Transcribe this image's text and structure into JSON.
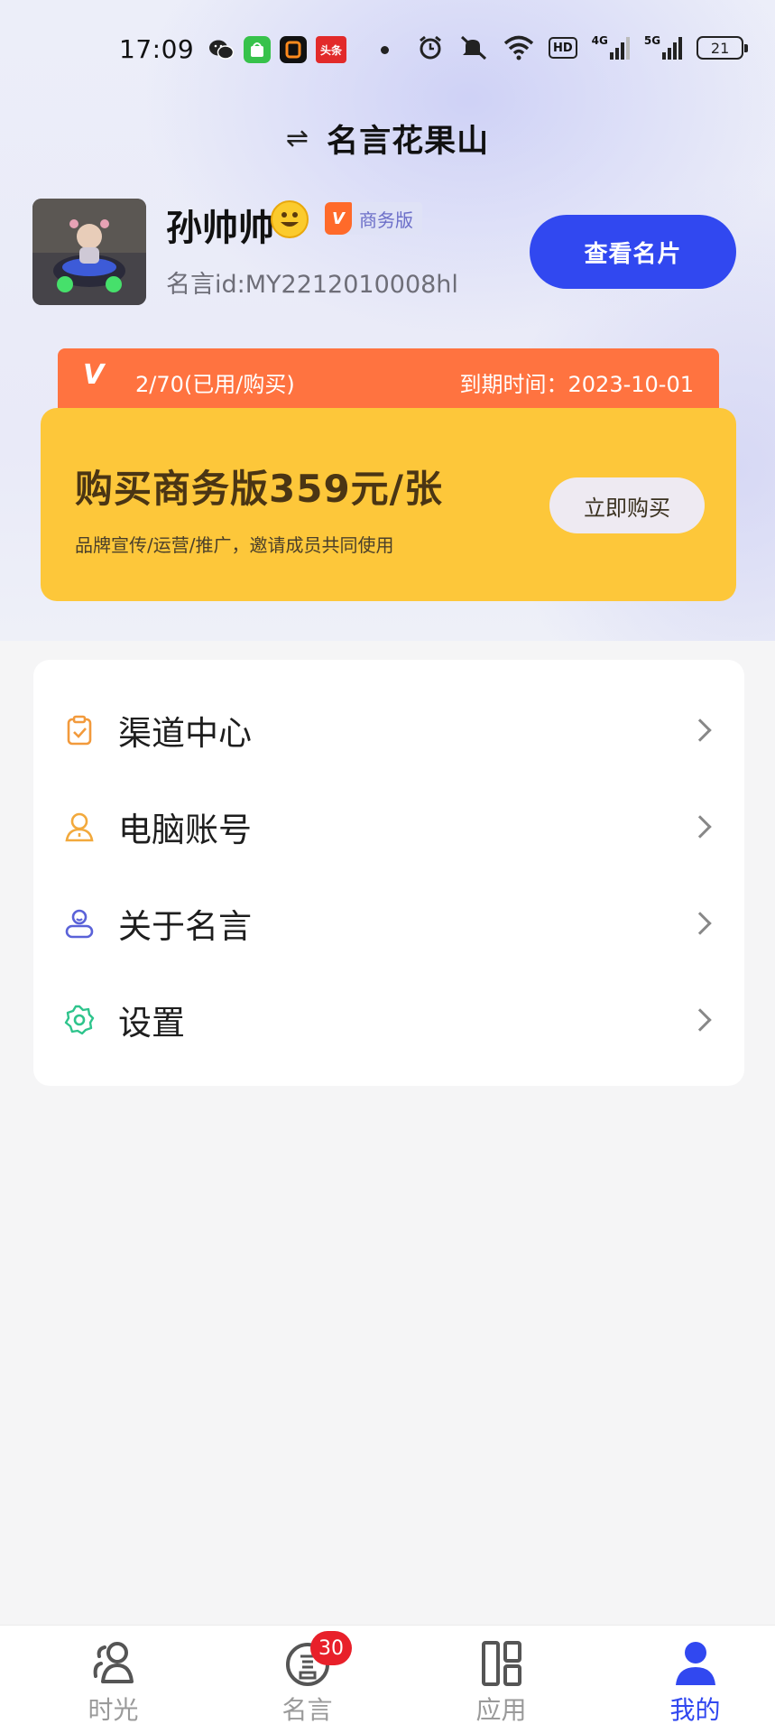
{
  "status_bar": {
    "time": "17:09",
    "notification_icons": [
      "wechat-icon",
      "android-market-icon",
      "bracket-app-icon",
      "toutiao-icon"
    ],
    "toutiao_label": "头条",
    "network_hd": "HD",
    "network_4g": "4G",
    "network_5g": "5G",
    "battery": "21"
  },
  "header": {
    "switch_icon": "⇌",
    "title": "名言花果山"
  },
  "profile": {
    "name": "孙帅帅",
    "emoji": "smiley-emoji",
    "badge_label": "商务版",
    "user_id": "名言id:MY2212010008hl",
    "card_button": "查看名片"
  },
  "usage": {
    "vip_logo": "V",
    "count": "2/70(已用/购买)",
    "expiry": "到期时间：2023-10-01"
  },
  "purchase": {
    "title": "购买商务版359元/张",
    "desc": "品牌宣传/运营/推广，邀请成员共同使用",
    "button": "立即购买"
  },
  "menu": {
    "items": [
      {
        "label": "渠道中心",
        "icon": "clipboard-check-icon",
        "color": "#f29a3c"
      },
      {
        "label": "电脑账号",
        "icon": "user-outline-icon",
        "color": "#f2a93c"
      },
      {
        "label": "关于名言",
        "icon": "person-badge-icon",
        "color": "#5a62d8"
      },
      {
        "label": "设置",
        "icon": "gear-icon",
        "color": "#2ec48c"
      }
    ]
  },
  "bottom_nav": {
    "items": [
      {
        "label": "时光",
        "icon": "users-icon",
        "active": false
      },
      {
        "label": "名言",
        "icon": "quote-circle-icon",
        "active": false,
        "badge": "30"
      },
      {
        "label": "应用",
        "icon": "apps-grid-icon",
        "active": false
      },
      {
        "label": "我的",
        "icon": "person-filled-icon",
        "active": true
      }
    ]
  },
  "colors": {
    "accent": "#3148f0",
    "orange": "#ff7340",
    "gold": "#fdc73a",
    "badge_red": "#e8202a"
  }
}
